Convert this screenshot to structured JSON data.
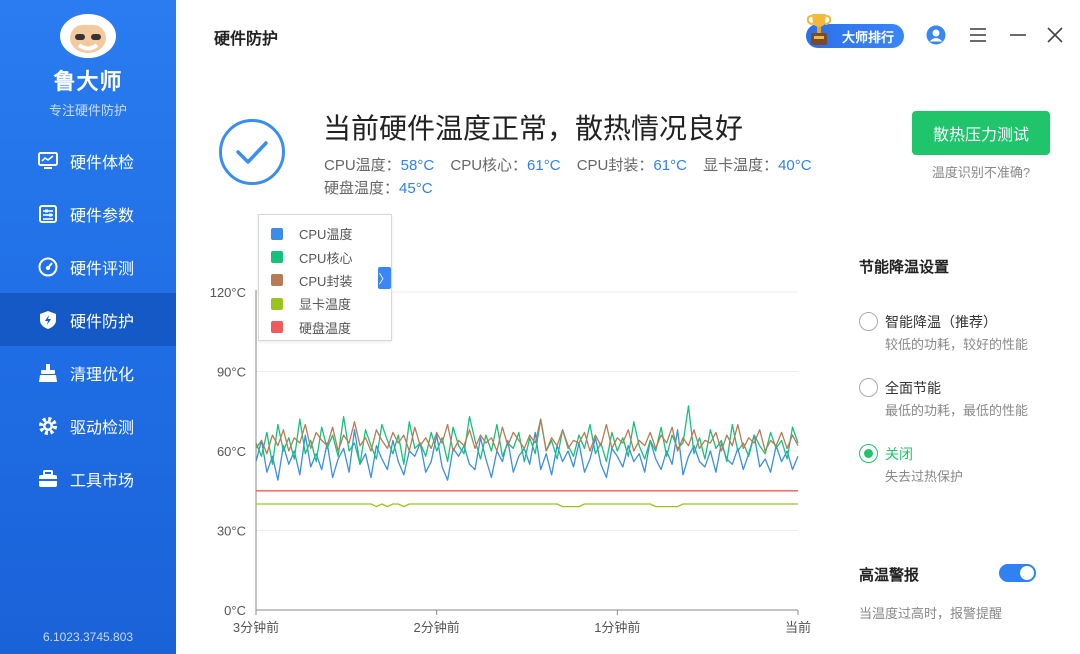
{
  "sidebar": {
    "app_name": "鲁大师",
    "slogan": "专注硬件防护",
    "items": [
      {
        "label": "硬件体检",
        "icon": "monitor-icon",
        "active": false
      },
      {
        "label": "硬件参数",
        "icon": "sliders-icon",
        "active": false
      },
      {
        "label": "硬件评测",
        "icon": "speedometer-icon",
        "active": false
      },
      {
        "label": "硬件防护",
        "icon": "shield-icon",
        "active": true
      },
      {
        "label": "清理优化",
        "icon": "broom-icon",
        "active": false
      },
      {
        "label": "驱动检测",
        "icon": "gear-icon",
        "active": false
      },
      {
        "label": "工具市场",
        "icon": "toolbox-icon",
        "active": false
      }
    ],
    "version": "6.1023.3745.803"
  },
  "header": {
    "title": "硬件防护",
    "rank_label": "大师排行"
  },
  "status": {
    "headline": "当前硬件温度正常，散热情况良好",
    "temps": [
      {
        "label": "CPU温度：",
        "value": "58°C"
      },
      {
        "label": "CPU核心：",
        "value": "61°C"
      },
      {
        "label": "CPU封装：",
        "value": "61°C"
      },
      {
        "label": "显卡温度：",
        "value": "40°C"
      },
      {
        "label": "硬盘温度：",
        "value": "45°C"
      }
    ],
    "stress_test_label": "散热压力测试",
    "inaccurate_link": "温度识别不准确?"
  },
  "legend_toggle": "〉",
  "chart_data": {
    "type": "line",
    "x_ticks": [
      "3分钟前",
      "2分钟前",
      "1分钟前",
      "当前"
    ],
    "y_ticks": [
      "0°C",
      "30°C",
      "60°C",
      "90°C",
      "120°C"
    ],
    "ylim": [
      0,
      120
    ],
    "grid": true,
    "legend_position": "top-left",
    "series": [
      {
        "name": "CPU温度",
        "color": "#3a8ee6",
        "values": [
          56,
          64,
          52,
          58,
          49,
          62,
          55,
          60,
          51,
          66,
          54,
          59,
          53,
          63,
          50,
          57,
          61,
          52,
          68,
          55,
          59,
          50,
          62,
          57,
          53,
          64,
          56,
          51,
          60,
          58,
          63,
          52,
          56,
          66,
          54,
          49,
          61,
          58,
          62,
          55,
          53,
          65,
          57,
          50,
          60,
          56,
          64,
          52,
          58,
          61,
          55,
          67,
          53,
          59,
          51,
          62,
          56,
          60,
          54,
          63,
          52,
          57,
          65,
          55,
          50,
          61,
          58,
          54,
          62,
          56,
          59,
          52,
          64,
          57,
          53,
          60,
          55,
          68,
          51,
          58,
          62,
          56,
          54,
          60,
          52,
          63,
          57,
          55,
          61,
          53,
          59,
          66,
          54,
          57,
          52,
          62,
          56,
          60,
          53,
          58
        ]
      },
      {
        "name": "CPU核心",
        "color": "#15c27b",
        "values": [
          63,
          58,
          67,
          55,
          70,
          60,
          65,
          57,
          72,
          59,
          64,
          56,
          69,
          61,
          66,
          58,
          73,
          60,
          63,
          55,
          68,
          62,
          57,
          70,
          64,
          59,
          66,
          55,
          71,
          61,
          63,
          58,
          67,
          60,
          65,
          56,
          69,
          62,
          59,
          73,
          64,
          57,
          66,
          60,
          70,
          58,
          63,
          61,
          67,
          56,
          65,
          59,
          72,
          60,
          64,
          57,
          68,
          62,
          58,
          66,
          61,
          70,
          59,
          63,
          56,
          67,
          60,
          65,
          58,
          71,
          62,
          57,
          64,
          60,
          69,
          58,
          66,
          61,
          63,
          77,
          59,
          65,
          57,
          68,
          61,
          64,
          56,
          70,
          60,
          63,
          58,
          66,
          62,
          59,
          67,
          61,
          64,
          57,
          69,
          63
        ]
      },
      {
        "name": "CPU封装",
        "color": "#b87b55",
        "values": [
          61,
          64,
          59,
          66,
          62,
          68,
          60,
          65,
          63,
          70,
          61,
          67,
          64,
          62,
          69,
          60,
          66,
          63,
          71,
          62,
          65,
          60,
          68,
          64,
          61,
          67,
          63,
          66,
          60,
          69,
          62,
          65,
          61,
          67,
          63,
          70,
          60,
          64,
          62,
          68,
          61,
          66,
          63,
          65,
          60,
          69,
          62,
          67,
          64,
          61,
          66,
          63,
          72,
          60,
          65,
          62,
          68,
          61,
          64,
          63,
          67,
          60,
          66,
          62,
          70,
          61,
          65,
          63,
          68,
          60,
          64,
          62,
          67,
          61,
          66,
          63,
          69,
          60,
          65,
          62,
          68,
          61,
          64,
          63,
          67,
          60,
          66,
          62,
          70,
          61,
          65,
          63,
          68,
          60,
          64,
          62,
          67,
          61,
          66,
          62
        ]
      },
      {
        "name": "显卡温度",
        "color": "#9cc31c",
        "values": [
          40,
          40,
          40,
          40,
          40,
          40,
          40,
          40,
          40,
          40,
          40,
          40,
          40,
          40,
          40,
          40,
          40,
          40,
          40,
          40,
          40,
          40,
          39,
          40,
          39,
          40,
          40,
          39,
          40,
          40,
          40,
          40,
          40,
          40,
          40,
          40,
          40,
          40,
          40,
          40,
          40,
          40,
          40,
          40,
          40,
          40,
          40,
          40,
          40,
          40,
          40,
          40,
          40,
          40,
          40,
          40,
          39,
          39,
          39,
          39,
          40,
          40,
          40,
          40,
          40,
          40,
          40,
          40,
          40,
          40,
          40,
          40,
          40,
          39,
          39,
          39,
          39,
          39,
          40,
          40,
          40,
          40,
          40,
          40,
          40,
          40,
          40,
          40,
          40,
          40,
          40,
          40,
          40,
          40,
          40,
          40,
          40,
          40,
          40,
          40
        ]
      },
      {
        "name": "硬盘温度",
        "color": "#f05a5a",
        "values": [
          45,
          45,
          45,
          45,
          45,
          45,
          45,
          45,
          45,
          45,
          45,
          45,
          45,
          45,
          45,
          45,
          45,
          45,
          45,
          45,
          45,
          45,
          45,
          45,
          45,
          45,
          45,
          45,
          45,
          45,
          45,
          45,
          45,
          45,
          45,
          45,
          45,
          45,
          45,
          45,
          45,
          45,
          45,
          45,
          45,
          45,
          45,
          45,
          45,
          45,
          45,
          45,
          45,
          45,
          45,
          45,
          45,
          45,
          45,
          45,
          45,
          45,
          45,
          45,
          45,
          45,
          45,
          45,
          45,
          45,
          45,
          45,
          45,
          45,
          45,
          45,
          45,
          45,
          45,
          45,
          45,
          45,
          45,
          45,
          45,
          45,
          45,
          45,
          45,
          45,
          45,
          45,
          45,
          45,
          45,
          45,
          45,
          45,
          45,
          45
        ]
      }
    ]
  },
  "cooling": {
    "title": "节能降温设置",
    "options": [
      {
        "label": "智能降温（推荐）",
        "desc": "较低的功耗，较好的性能",
        "selected": false
      },
      {
        "label": "全面节能",
        "desc": "最低的功耗，最低的性能",
        "selected": false
      },
      {
        "label": "关闭",
        "desc": "失去过热保护",
        "selected": true
      }
    ]
  },
  "alarm": {
    "title": "高温警报",
    "enabled": true,
    "desc": "当温度过高时，报警提醒"
  }
}
